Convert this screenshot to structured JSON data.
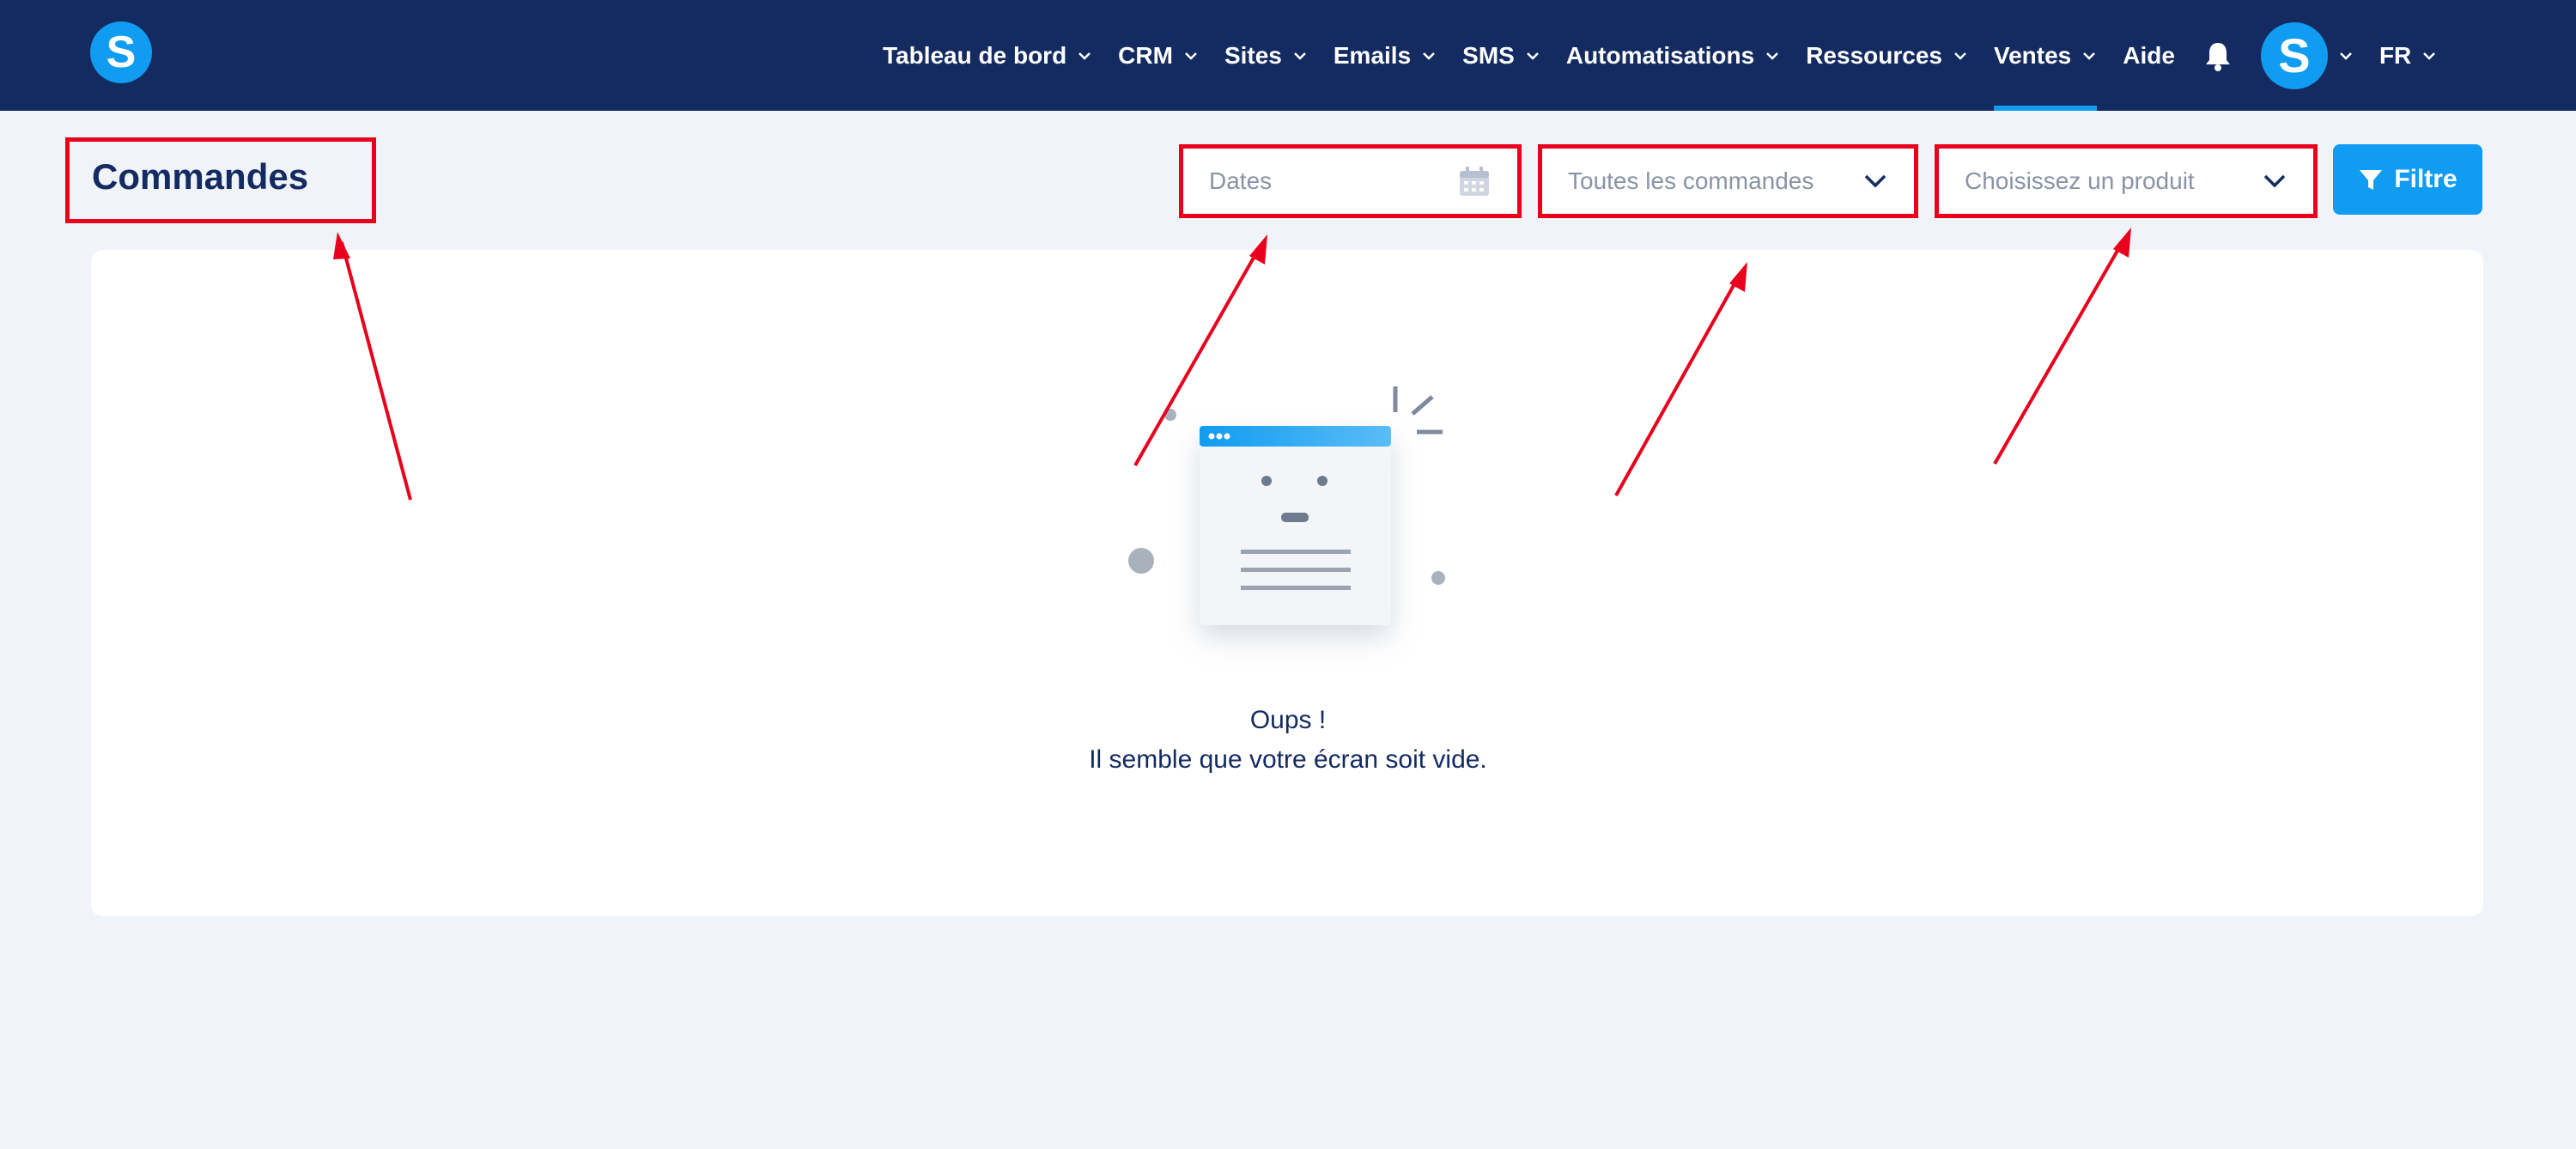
{
  "brand": {
    "logo_letter": "S"
  },
  "nav": {
    "items": [
      {
        "label": "Tableau de bord",
        "has_dropdown": true
      },
      {
        "label": "CRM",
        "has_dropdown": true
      },
      {
        "label": "Sites",
        "has_dropdown": true
      },
      {
        "label": "Emails",
        "has_dropdown": true
      },
      {
        "label": "SMS",
        "has_dropdown": true
      },
      {
        "label": "Automatisations",
        "has_dropdown": true
      },
      {
        "label": "Ressources",
        "has_dropdown": true
      },
      {
        "label": "Ventes",
        "has_dropdown": true,
        "active": true
      },
      {
        "label": "Aide",
        "has_dropdown": false
      }
    ],
    "avatar_letter": "S",
    "language": "FR"
  },
  "page": {
    "title": "Commandes"
  },
  "filters": {
    "dates_placeholder": "Dates",
    "orders_select": "Toutes les commandes",
    "product_select": "Choisissez un produit",
    "filter_button": "Filtre"
  },
  "empty_state": {
    "title": "Oups !",
    "message": "Il semble que votre écran soit vide."
  },
  "colors": {
    "header_bg": "#142b61",
    "accent": "#109cf1",
    "annotation": "#e8001c",
    "page_bg": "#f0f3f8"
  }
}
